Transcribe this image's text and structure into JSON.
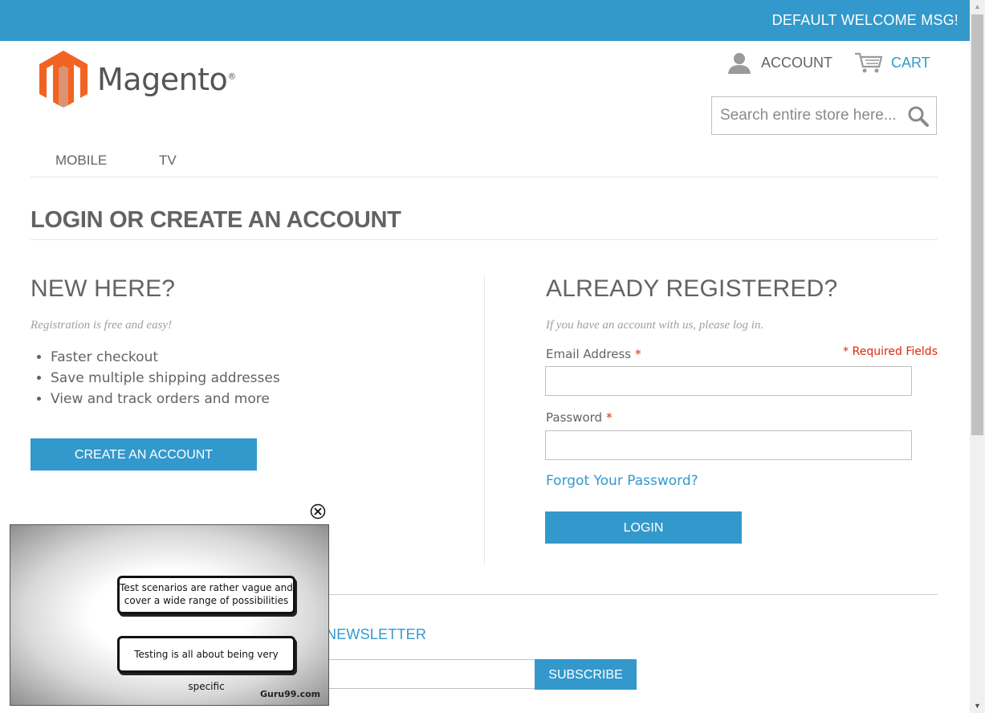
{
  "header": {
    "welcome": "DEFAULT WELCOME MSG!",
    "logo_text": "Magento",
    "logo_reg": "®",
    "account_label": "ACCOUNT",
    "cart_label": "CART",
    "search_placeholder": "Search entire store here..."
  },
  "nav": {
    "items": [
      {
        "label": "MOBILE"
      },
      {
        "label": "TV"
      }
    ]
  },
  "page": {
    "title": "LOGIN OR CREATE AN ACCOUNT"
  },
  "new_customer": {
    "heading": "NEW HERE?",
    "subtitle": "Registration is free and easy!",
    "benefits": [
      "Faster checkout",
      "Save multiple shipping addresses",
      "View and track orders and more"
    ],
    "button_label": "CREATE AN ACCOUNT"
  },
  "login": {
    "heading": "ALREADY REGISTERED?",
    "subtitle": "If you have an account with us, please log in.",
    "required_note": "* Required Fields",
    "email_label": "Email Address",
    "password_label": "Password",
    "required_star": "*",
    "email_value": "",
    "password_value": "",
    "forgot_label": "Forgot Your Password?",
    "button_label": "LOGIN"
  },
  "footer": {
    "newsletter_label": "NEWSLETTER",
    "subscribe_label": "SUBSCRIBE"
  },
  "video_overlay": {
    "bubble_1": "Test scenarios are rather vague and cover a wide range of possibilities",
    "bubble_2": "Testing is all about being very specific",
    "watermark": "Guru99.com"
  },
  "colors": {
    "accent": "#3399cc",
    "required": "#df280a",
    "text": "#636363",
    "logo_orange": "#f26322"
  }
}
